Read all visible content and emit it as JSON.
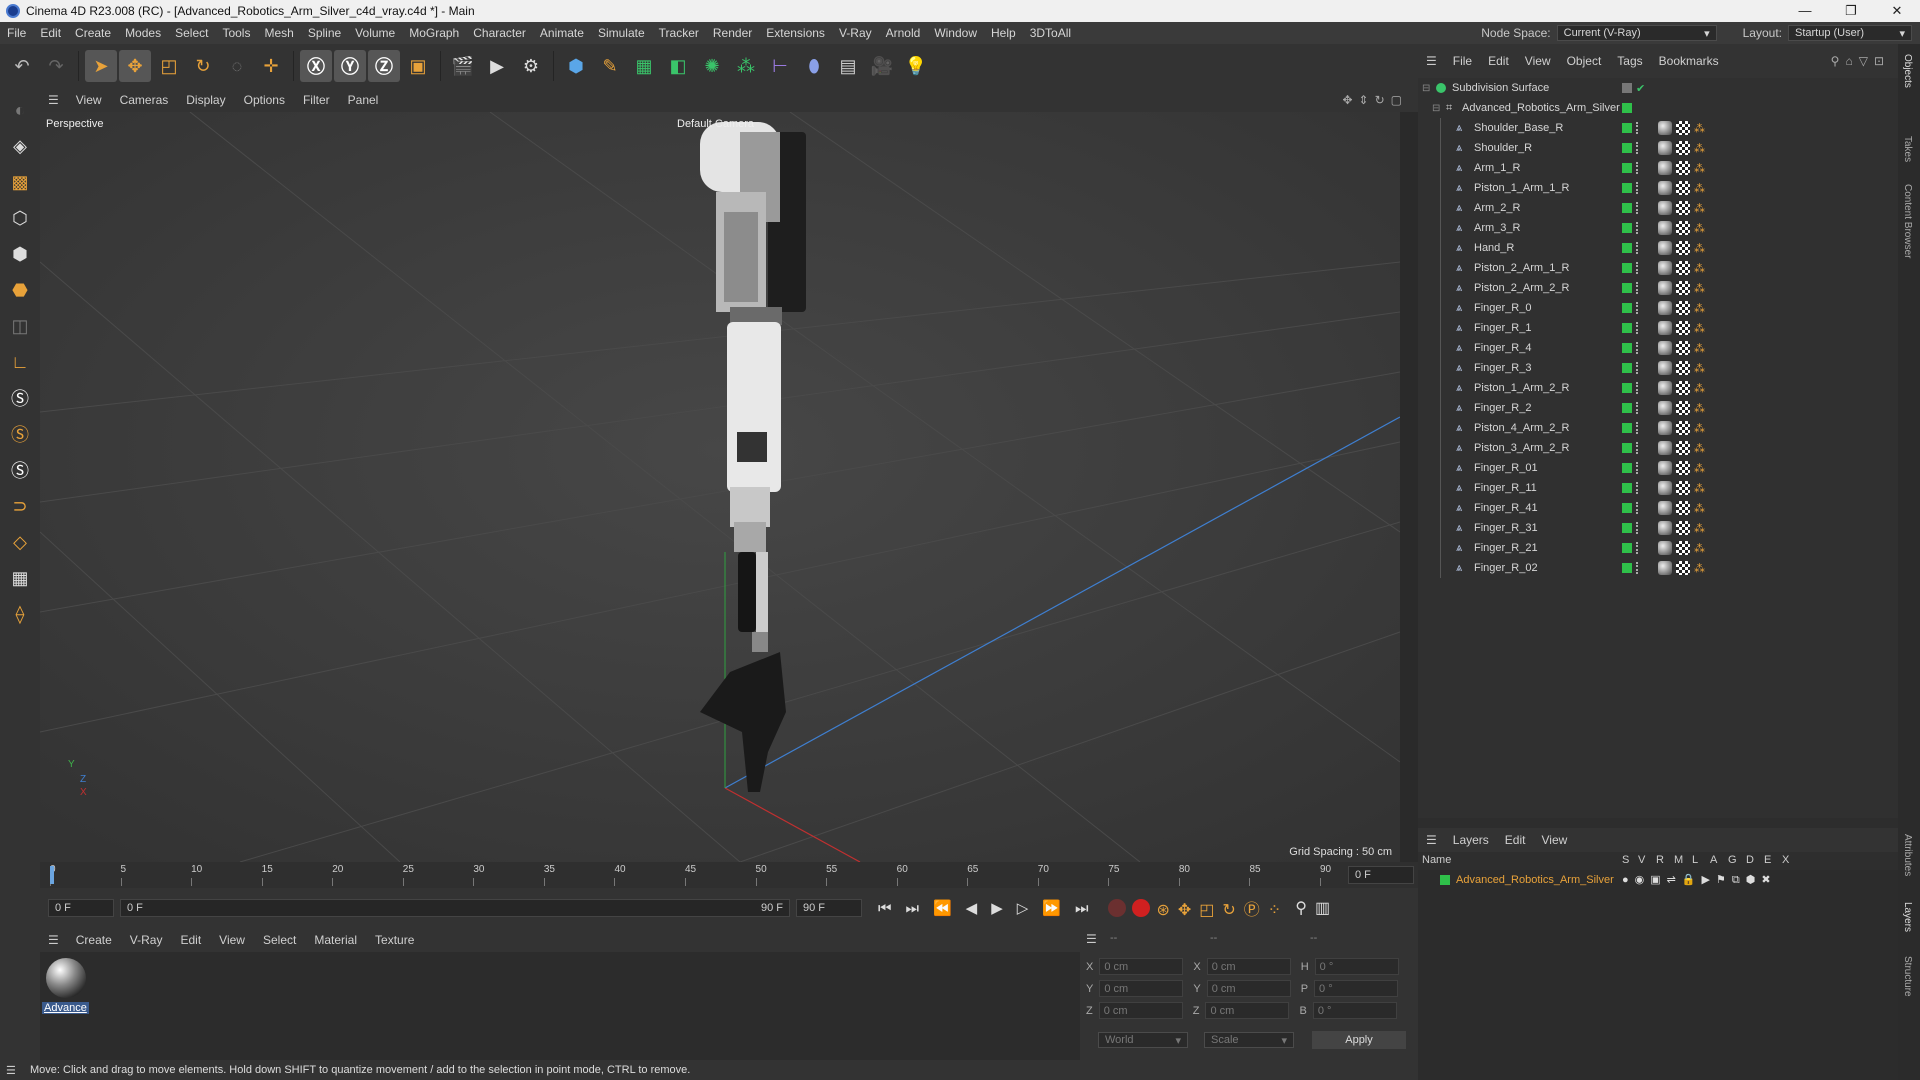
{
  "title_bar": {
    "title": "Cinema 4D R23.008 (RC) - [Advanced_Robotics_Arm_Silver_c4d_vray.c4d *] - Main",
    "minimize": "—",
    "maximize": "❐",
    "close": "✕"
  },
  "menu": [
    "File",
    "Edit",
    "Create",
    "Modes",
    "Select",
    "Tools",
    "Mesh",
    "Spline",
    "Volume",
    "MoGraph",
    "Character",
    "Animate",
    "Simulate",
    "Tracker",
    "Render",
    "Extensions",
    "V-Ray",
    "Arnold",
    "Window",
    "Help",
    "3DToAll"
  ],
  "node_space": {
    "label": "Node Space:",
    "value": "Current (V-Ray)"
  },
  "layout": {
    "label": "Layout:",
    "value": "Startup (User)"
  },
  "viewport": {
    "menu": [
      "View",
      "Cameras",
      "Display",
      "Options",
      "Filter",
      "Panel"
    ],
    "name": "Perspective",
    "camera": "Default Camera",
    "grid_spacing": "Grid Spacing : 50 cm",
    "axis_y": "Y",
    "axis_z": "Z",
    "axis_x": "X"
  },
  "timeline": {
    "ticks": [
      "0",
      "5",
      "10",
      "15",
      "20",
      "25",
      "30",
      "35",
      "40",
      "45",
      "50",
      "55",
      "60",
      "65",
      "70",
      "75",
      "80",
      "85",
      "90"
    ],
    "current_frame": "0 F",
    "start": "0 F",
    "range_start": "0 F",
    "range_end": "90 F",
    "end": "90 F"
  },
  "material_menu": [
    "Create",
    "V-Ray",
    "Edit",
    "View",
    "Select",
    "Material",
    "Texture"
  ],
  "material": {
    "name": "Advance"
  },
  "coords": {
    "header": [
      "--",
      "--",
      "--"
    ],
    "rows": [
      {
        "a": "X",
        "av": "0 cm",
        "b": "X",
        "bv": "0 cm",
        "c": "H",
        "cv": "0 °"
      },
      {
        "a": "Y",
        "av": "0 cm",
        "b": "Y",
        "bv": "0 cm",
        "c": "P",
        "cv": "0 °"
      },
      {
        "a": "Z",
        "av": "0 cm",
        "b": "Z",
        "bv": "0 cm",
        "c": "B",
        "cv": "0 °"
      }
    ],
    "world": "World",
    "scale": "Scale",
    "apply": "Apply"
  },
  "status": "Move: Click and drag to move elements. Hold down SHIFT to quantize movement / add to the selection in point mode, CTRL to remove.",
  "object_manager": {
    "menu": [
      "File",
      "Edit",
      "View",
      "Object",
      "Tags",
      "Bookmarks"
    ],
    "root": "Subdivision Surface",
    "group": "Advanced_Robotics_Arm_Silver",
    "children": [
      "Shoulder_Base_R",
      "Shoulder_R",
      "Arm_1_R",
      "Piston_1_Arm_1_R",
      "Arm_2_R",
      "Arm_3_R",
      "Hand_R",
      "Piston_2_Arm_1_R",
      "Piston_2_Arm_2_R",
      "Finger_R_0",
      "Finger_R_1",
      "Finger_R_4",
      "Finger_R_3",
      "Piston_1_Arm_2_R",
      "Finger_R_2",
      "Piston_4_Arm_2_R",
      "Piston_3_Arm_2_R",
      "Finger_R_01",
      "Finger_R_11",
      "Finger_R_41",
      "Finger_R_31",
      "Finger_R_21",
      "Finger_R_02"
    ]
  },
  "layers": {
    "menu": [
      "Layers",
      "Edit",
      "View"
    ],
    "columns": {
      "name": "Name",
      "flags": [
        "S",
        "V",
        "R",
        "M",
        "L",
        "A",
        "G",
        "D",
        "E",
        "X"
      ]
    },
    "rows": [
      {
        "name": "Advanced_Robotics_Arm_Silver",
        "color": "#2fc04a"
      }
    ]
  },
  "right_tabs": [
    "Objects",
    "Takes",
    "Content Browser",
    "Attributes",
    "Layers",
    "Structure"
  ]
}
